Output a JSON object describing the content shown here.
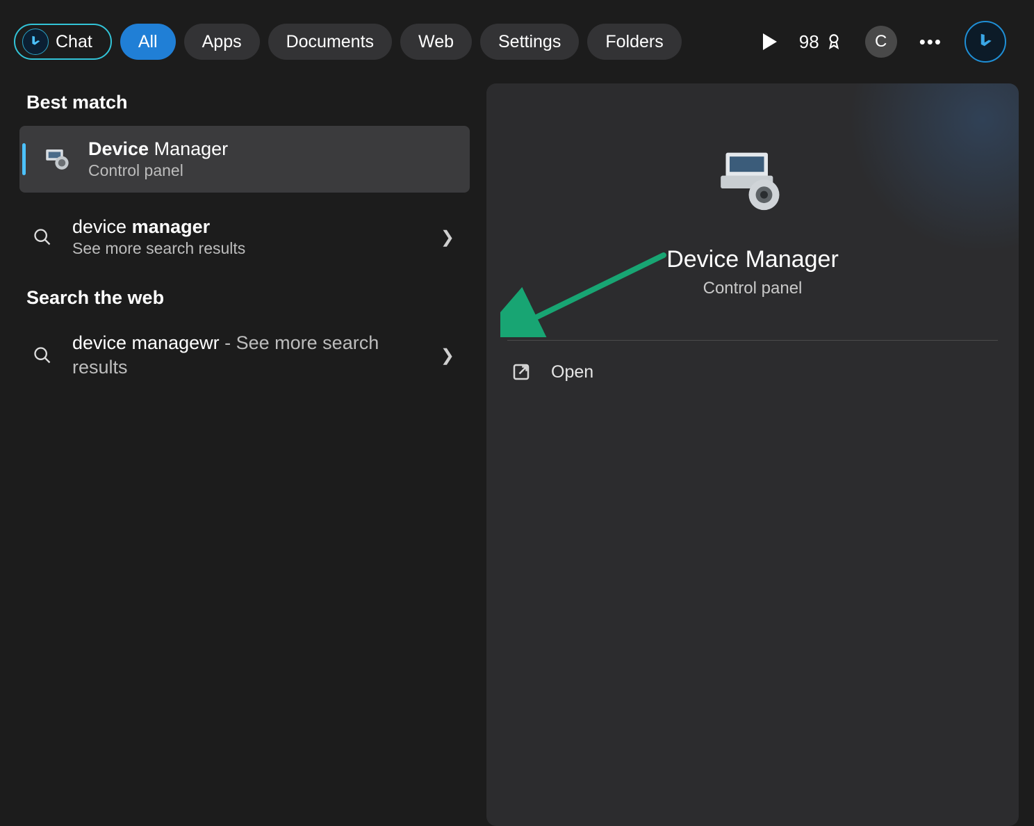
{
  "topbar": {
    "chat": "Chat",
    "tabs": [
      "All",
      "Apps",
      "Documents",
      "Web",
      "Settings",
      "Folders"
    ],
    "rewards_points": "98",
    "user_initial": "C"
  },
  "left": {
    "best_match_header": "Best match",
    "best_match": {
      "title_bold": "Device",
      "title_rest": " Manager",
      "subtitle": "Control panel"
    },
    "result_more": {
      "title_plain": "device ",
      "title_bold": "manager",
      "subtitle": "See more search results"
    },
    "search_web_header": "Search the web",
    "web_result": {
      "title": "device managewr",
      "suffix": " - See more search results"
    }
  },
  "detail": {
    "title": "Device Manager",
    "subtitle": "Control panel",
    "open_label": "Open"
  },
  "annotation": {
    "arrow_color": "#18a573"
  }
}
